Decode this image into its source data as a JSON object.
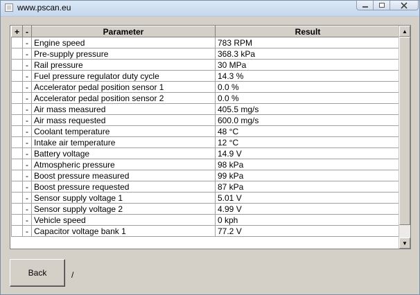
{
  "window": {
    "title": "www.pscan.eu",
    "buttons": {
      "minimize": "minimize",
      "maximize": "maximize",
      "close": "close"
    }
  },
  "table": {
    "headers": {
      "expand": "+",
      "collapse": "-",
      "parameter": "Parameter",
      "result": "Result"
    },
    "rows": [
      {
        "mark": "-",
        "parameter": "Engine speed",
        "result": "783 RPM"
      },
      {
        "mark": "-",
        "parameter": "Pre-supply pressure",
        "result": "368.3 kPa"
      },
      {
        "mark": "-",
        "parameter": "Rail pressure",
        "result": "30 MPa"
      },
      {
        "mark": "-",
        "parameter": "Fuel pressure regulator duty cycle",
        "result": "14.3 %"
      },
      {
        "mark": "-",
        "parameter": "Accelerator pedal position sensor 1",
        "result": "0.0 %"
      },
      {
        "mark": "-",
        "parameter": "Accelerator pedal position sensor 2",
        "result": "0.0 %"
      },
      {
        "mark": "-",
        "parameter": "Air mass measured",
        "result": "405.5 mg/s"
      },
      {
        "mark": "-",
        "parameter": "Air mass requested",
        "result": "600.0 mg/s"
      },
      {
        "mark": "-",
        "parameter": "Coolant temperature",
        "result": "48 °C"
      },
      {
        "mark": "-",
        "parameter": "Intake air temperature",
        "result": "12 °C"
      },
      {
        "mark": "-",
        "parameter": "Battery voltage",
        "result": "14.9 V"
      },
      {
        "mark": "-",
        "parameter": "Atmospheric pressure",
        "result": "98 kPa"
      },
      {
        "mark": "-",
        "parameter": "Boost pressure measured",
        "result": "99 kPa"
      },
      {
        "mark": "-",
        "parameter": "Boost pressure requested",
        "result": "87 kPa"
      },
      {
        "mark": "-",
        "parameter": "Sensor supply voltage 1",
        "result": "5.01 V"
      },
      {
        "mark": "-",
        "parameter": "Sensor supply voltage 2",
        "result": "4.99 V"
      },
      {
        "mark": "-",
        "parameter": "Vehicle speed",
        "result": "0 kph"
      },
      {
        "mark": "-",
        "parameter": "Capacitor voltage bank 1",
        "result": "77.2 V"
      }
    ]
  },
  "footer": {
    "back_label": "Back",
    "page_indicator": "/"
  }
}
